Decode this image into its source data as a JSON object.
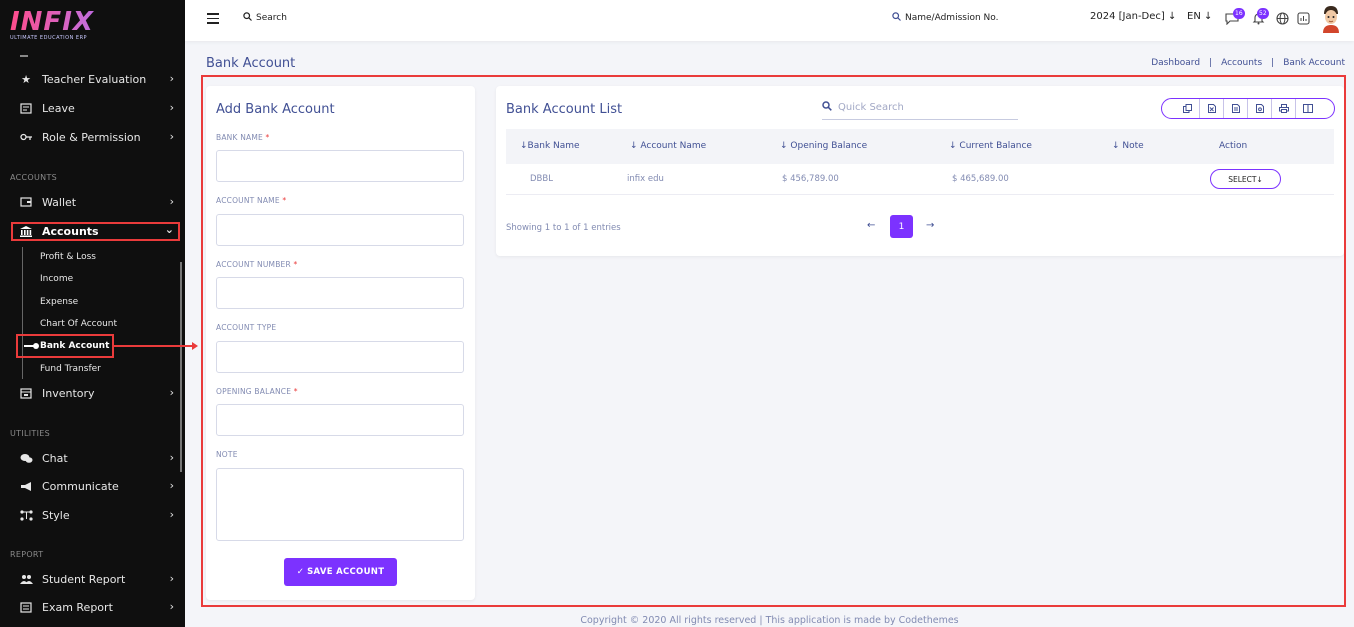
{
  "app": {
    "logo_text": "INFIX",
    "logo_subtitle": "ULTIMATE EDUCATION ERP"
  },
  "sidebar": {
    "items": [
      {
        "label": "Teacher Evaluation",
        "icon": "star-icon"
      },
      {
        "label": "Leave",
        "icon": "leave-icon"
      },
      {
        "label": "Role & Permission",
        "icon": "key-icon"
      }
    ],
    "section_accounts": "ACCOUNTS",
    "wallet": "Wallet",
    "accounts": "Accounts",
    "accounts_sub": [
      "Profit & Loss",
      "Income",
      "Expense",
      "Chart Of Account",
      "Bank Account",
      "Fund Transfer"
    ],
    "inventory": "Inventory",
    "section_utilities": "UTILITIES",
    "chat": "Chat",
    "communicate": "Communicate",
    "style": "Style",
    "section_report": "REPORT",
    "student_report": "Student Report",
    "exam_report": "Exam Report"
  },
  "topbar": {
    "search_label": "Search",
    "name_search_label": "Name/Admission No.",
    "session": "2024 [Jan-Dec]",
    "language": "EN",
    "messages_count": "16",
    "notifications_count": "52"
  },
  "page": {
    "title": "Bank Account",
    "breadcrumb": [
      "Dashboard",
      "Accounts",
      "Bank Account"
    ]
  },
  "form": {
    "title": "Add Bank Account",
    "bank_name_label": "BANK NAME",
    "account_name_label": "ACCOUNT NAME",
    "account_number_label": "ACCOUNT NUMBER",
    "account_type_label": "ACCOUNT TYPE",
    "opening_balance_label": "OPENING BALANCE",
    "note_label": "NOTE",
    "required_mark": "*",
    "save_label": "SAVE ACCOUNT"
  },
  "list": {
    "title": "Bank Account List",
    "quick_search_placeholder": "Quick Search",
    "columns": [
      "Bank Name",
      "Account Name",
      "Opening Balance",
      "Current Balance",
      "Note",
      "Action"
    ],
    "rows": [
      {
        "bank_name": "DBBL",
        "account_name": "infix edu",
        "opening_balance": "$ 456,789.00",
        "current_balance": "$ 465,689.00",
        "note": "",
        "action": "SELECT"
      }
    ],
    "showing": "Showing 1 to 1 of 1 entries",
    "current_page": "1"
  },
  "footer": {
    "text": "Copyright © 2020 All rights reserved | This application is made by Codethemes"
  },
  "colors": {
    "accent": "#7c32ff",
    "highlight": "#ea3b3b",
    "text_primary": "#415094",
    "sidebar_bg": "#0f0f0f"
  }
}
